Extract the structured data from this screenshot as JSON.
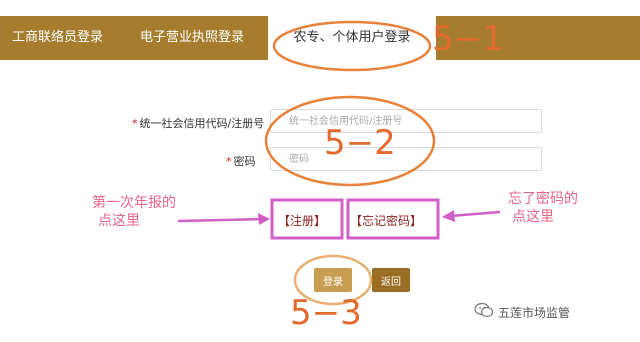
{
  "tabs": [
    {
      "label": "工商联络员登录"
    },
    {
      "label": "电子营业执照登录"
    },
    {
      "label": "农专、个体用户登录"
    }
  ],
  "form": {
    "code_label": "统一社会信用代码/注册号",
    "code_placeholder": "统一社会信用代码/注册号",
    "password_label": "密码",
    "password_placeholder": "密码",
    "required_mark": "*",
    "register_link": "【注册】",
    "forgot_link": "【忘记密码】",
    "login_button": "登录",
    "back_button": "返回"
  },
  "annotations": {
    "step_tab": "5−1",
    "step_fields": "5−2",
    "step_login": "5−3",
    "note_register": [
      "第一次年报的",
      "点这里"
    ],
    "note_forgot": [
      "忘了密码的",
      "点这里"
    ],
    "annotation_color": "#e26a2c",
    "highlight_color": "#d25fc8",
    "note_color": "#e6648a"
  },
  "watermark": {
    "text": "五莲市场监管",
    "icon": "wechat-icon"
  },
  "colors": {
    "tabbar": "#a67c2f",
    "login_button": "#c79e52",
    "back_button": "#9a6d24"
  }
}
